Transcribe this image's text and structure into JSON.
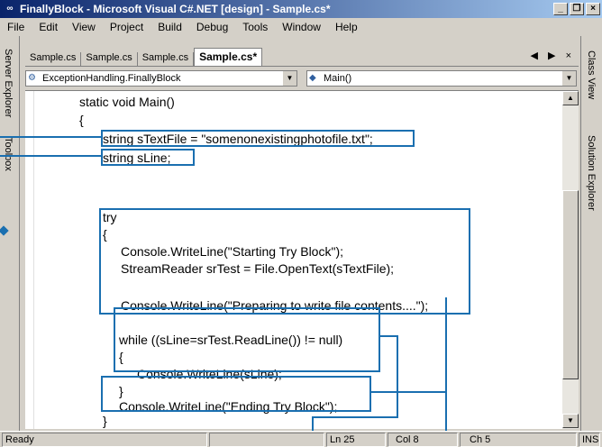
{
  "window": {
    "title": "FinallyBlock - Microsoft Visual C#.NET [design] - Sample.cs*",
    "min": "_",
    "max": "©",
    "close": "×"
  },
  "menu": [
    "File",
    "Edit",
    "View",
    "Project",
    "Build",
    "Debug",
    "Tools",
    "Window",
    "Help"
  ],
  "left_dock": {
    "server_explorer": "Server Explorer",
    "toolbox": "Toolbox"
  },
  "right_dock": {
    "class_view": "Class View",
    "solution_explorer": "Solution Explorer"
  },
  "tabs": [
    "Sample.cs",
    "Sample.cs",
    "Sample.cs",
    "Sample.cs*"
  ],
  "tab_nav": "◀ ▶ ×",
  "nav": {
    "class_combo": "ExceptionHandling.FinallyBlock",
    "member_combo": "Main()"
  },
  "code": {
    "l1": "static void Main()",
    "l2": "{",
    "l3": "string sTextFile = \"somenonexistingphotofile.txt\";",
    "l4": "string sLine;",
    "l5": "try",
    "l6": "{",
    "l7": "Console.WriteLine(\"Starting Try Block\");",
    "l8": "StreamReader srTest = File.OpenText(sTextFile);",
    "l9": "Console.WriteLine(\"Preparing to write file contents....\");",
    "l10": "while ((sLine=srTest.ReadLine()) != null)",
    "l11": "{",
    "l12": "Console.WriteLine(sLine);",
    "l13": "}",
    "l14": "Console.WriteLine(\"Ending Try Block\");",
    "l15": "}",
    "l16": "}"
  },
  "status": {
    "ready": "Ready",
    "ln": "Ln 25",
    "col": "Col 8",
    "ch": "Ch 5",
    "ins": "INS"
  },
  "colors": {
    "callout": "#1a6fb0",
    "title_start": "#0a246a",
    "title_end": "#a6caf0"
  }
}
